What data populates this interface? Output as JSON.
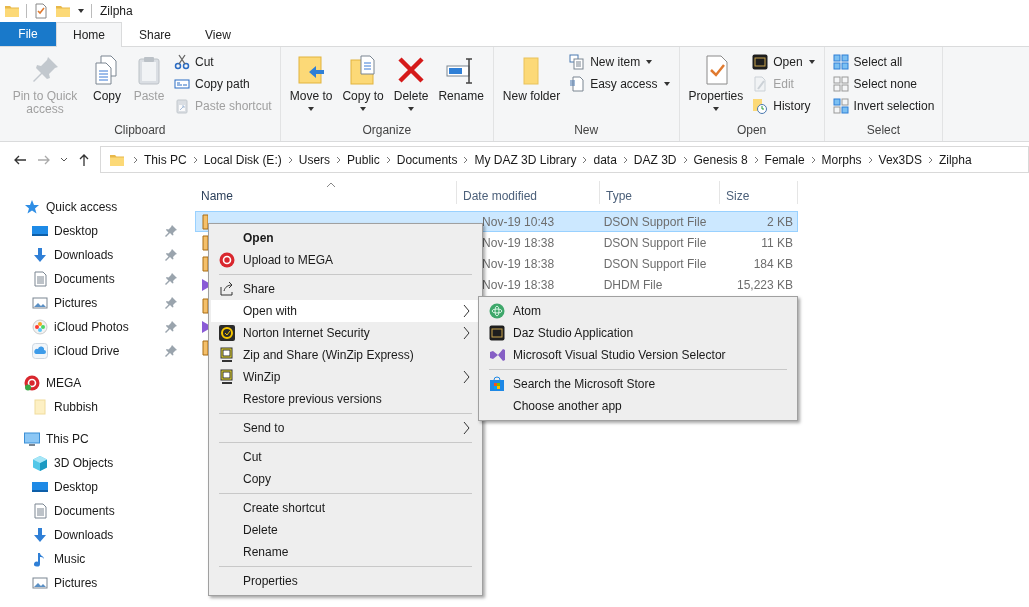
{
  "window": {
    "title": "Zilpha"
  },
  "ribbon_tabs": [
    {
      "label": "File",
      "kind": "file",
      "selected": false
    },
    {
      "label": "Home",
      "kind": "tab",
      "selected": true
    },
    {
      "label": "Share",
      "kind": "tab",
      "selected": false
    },
    {
      "label": "View",
      "kind": "tab",
      "selected": false
    }
  ],
  "ribbon_groups": [
    {
      "label": "Clipboard",
      "items": [
        {
          "label": "Pin to Quick access",
          "kind": "large",
          "dropdown": false,
          "disabled": true
        },
        {
          "label": "Copy",
          "kind": "large",
          "dropdown": false,
          "disabled": false
        },
        {
          "label": "Paste",
          "kind": "large",
          "dropdown": false,
          "disabled": true
        },
        {
          "label": "Cut",
          "kind": "small",
          "dropdown": false,
          "disabled": false
        },
        {
          "label": "Copy path",
          "kind": "small",
          "dropdown": false,
          "disabled": false
        },
        {
          "label": "Paste shortcut",
          "kind": "small",
          "dropdown": false,
          "disabled": true
        }
      ]
    },
    {
      "label": "Organize",
      "items": [
        {
          "label": "Move to",
          "kind": "large",
          "dropdown": true,
          "disabled": false
        },
        {
          "label": "Copy to",
          "kind": "large",
          "dropdown": true,
          "disabled": false
        },
        {
          "label": "Delete",
          "kind": "large",
          "dropdown": true,
          "disabled": false
        },
        {
          "label": "Rename",
          "kind": "large",
          "dropdown": false,
          "disabled": false
        }
      ]
    },
    {
      "label": "New",
      "items": [
        {
          "label": "New folder",
          "kind": "large",
          "dropdown": false,
          "disabled": false
        },
        {
          "label": "New item",
          "kind": "small",
          "dropdown": true,
          "disabled": false
        },
        {
          "label": "Easy access",
          "kind": "small",
          "dropdown": true,
          "disabled": false
        }
      ]
    },
    {
      "label": "Open",
      "items": [
        {
          "label": "Properties",
          "kind": "large",
          "dropdown": true,
          "disabled": false
        },
        {
          "label": "Open",
          "kind": "small",
          "dropdown": true,
          "disabled": false
        },
        {
          "label": "Edit",
          "kind": "small",
          "dropdown": false,
          "disabled": true
        },
        {
          "label": "History",
          "kind": "small",
          "dropdown": false,
          "disabled": false
        }
      ]
    },
    {
      "label": "Select",
      "items": [
        {
          "label": "Select all",
          "kind": "small",
          "dropdown": false,
          "disabled": false
        },
        {
          "label": "Select none",
          "kind": "small",
          "dropdown": false,
          "disabled": false
        },
        {
          "label": "Invert selection",
          "kind": "small",
          "dropdown": false,
          "disabled": false
        }
      ]
    }
  ],
  "address_bar": {
    "breadcrumbs": [
      "This PC",
      "Local Disk (E:)",
      "Users",
      "Public",
      "Documents",
      "My DAZ 3D Library",
      "data",
      "DAZ 3D",
      "Genesis 8",
      "Female",
      "Morphs",
      "Vex3DS",
      "Zilpha"
    ]
  },
  "navigation_pane": {
    "groups": [
      {
        "label": "Quick access",
        "children": [
          {
            "label": "Desktop",
            "pinned": true
          },
          {
            "label": "Downloads",
            "pinned": true
          },
          {
            "label": "Documents",
            "pinned": true
          },
          {
            "label": "Pictures",
            "pinned": true
          },
          {
            "label": "iCloud Photos",
            "pinned": true
          },
          {
            "label": "iCloud Drive",
            "pinned": true
          }
        ]
      },
      {
        "label": "MEGA",
        "children": [
          {
            "label": "Rubbish",
            "pinned": false
          }
        ]
      },
      {
        "label": "This PC",
        "children": [
          {
            "label": "3D Objects",
            "pinned": false
          },
          {
            "label": "Desktop",
            "pinned": false
          },
          {
            "label": "Documents",
            "pinned": false
          },
          {
            "label": "Downloads",
            "pinned": false
          },
          {
            "label": "Music",
            "pinned": false
          },
          {
            "label": "Pictures",
            "pinned": false
          }
        ]
      }
    ]
  },
  "file_list": {
    "columns": [
      {
        "label": "Name",
        "sorted": true
      },
      {
        "label": "Date modified",
        "sorted": false
      },
      {
        "label": "Type",
        "sorted": false
      },
      {
        "label": "Size",
        "sorted": false
      }
    ],
    "rows": [
      {
        "kind": "dson",
        "date_modified": "Nov-19 10:43",
        "type": "DSON Support File",
        "size": "2 KB",
        "selected": true
      },
      {
        "kind": "dson",
        "date_modified": "Nov-19 18:38",
        "type": "DSON Support File",
        "size": "11 KB",
        "selected": false
      },
      {
        "kind": "dson",
        "date_modified": "Nov-19 18:38",
        "type": "DSON Support File",
        "size": "184 KB",
        "selected": false
      },
      {
        "kind": "dhdm",
        "date_modified": "Nov-19 18:38",
        "type": "DHDM File",
        "size": "15,223 KB",
        "selected": false
      },
      {
        "kind": "dson",
        "selected": false
      },
      {
        "kind": "dhdm",
        "selected": false
      },
      {
        "kind": "dson",
        "selected": false
      }
    ]
  },
  "context_menu": {
    "items": [
      {
        "kind": "item",
        "label": "Open",
        "default": true,
        "submenu": false,
        "selected": false
      },
      {
        "kind": "item",
        "label": "Upload to MEGA",
        "default": false,
        "submenu": false,
        "selected": false
      },
      {
        "kind": "separator"
      },
      {
        "kind": "item",
        "label": "Share",
        "default": false,
        "submenu": false,
        "selected": false
      },
      {
        "kind": "item",
        "label": "Open with",
        "default": false,
        "submenu": true,
        "selected": true
      },
      {
        "kind": "item",
        "label": "Norton Internet Security",
        "default": false,
        "submenu": true,
        "selected": false
      },
      {
        "kind": "item",
        "label": "Zip and Share (WinZip Express)",
        "default": false,
        "submenu": false,
        "selected": false
      },
      {
        "kind": "item",
        "label": "WinZip",
        "default": false,
        "submenu": true,
        "selected": false
      },
      {
        "kind": "item",
        "label": "Restore previous versions",
        "default": false,
        "submenu": false,
        "selected": false
      },
      {
        "kind": "separator"
      },
      {
        "kind": "item",
        "label": "Send to",
        "default": false,
        "submenu": true,
        "selected": false
      },
      {
        "kind": "separator"
      },
      {
        "kind": "item",
        "label": "Cut",
        "default": false,
        "submenu": false,
        "selected": false
      },
      {
        "kind": "item",
        "label": "Copy",
        "default": false,
        "submenu": false,
        "selected": false
      },
      {
        "kind": "separator"
      },
      {
        "kind": "item",
        "label": "Create shortcut",
        "default": false,
        "submenu": false,
        "selected": false
      },
      {
        "kind": "item",
        "label": "Delete",
        "default": false,
        "submenu": false,
        "selected": false
      },
      {
        "kind": "item",
        "label": "Rename",
        "default": false,
        "submenu": false,
        "selected": false
      },
      {
        "kind": "separator"
      },
      {
        "kind": "item",
        "label": "Properties",
        "default": false,
        "submenu": false,
        "selected": false
      }
    ]
  },
  "open_with_submenu": {
    "items": [
      {
        "kind": "item",
        "label": "Atom",
        "default": false,
        "submenu": false,
        "selected": false
      },
      {
        "kind": "item",
        "label": "Daz Studio Application",
        "default": false,
        "submenu": false,
        "selected": false
      },
      {
        "kind": "item",
        "label": "Microsoft Visual Studio Version Selector",
        "default": false,
        "submenu": false,
        "selected": false
      },
      {
        "kind": "separator"
      },
      {
        "kind": "item",
        "label": "Search the Microsoft Store",
        "default": false,
        "submenu": false,
        "selected": false
      },
      {
        "kind": "item",
        "label": "Choose another app",
        "default": false,
        "submenu": false,
        "selected": false
      }
    ]
  }
}
